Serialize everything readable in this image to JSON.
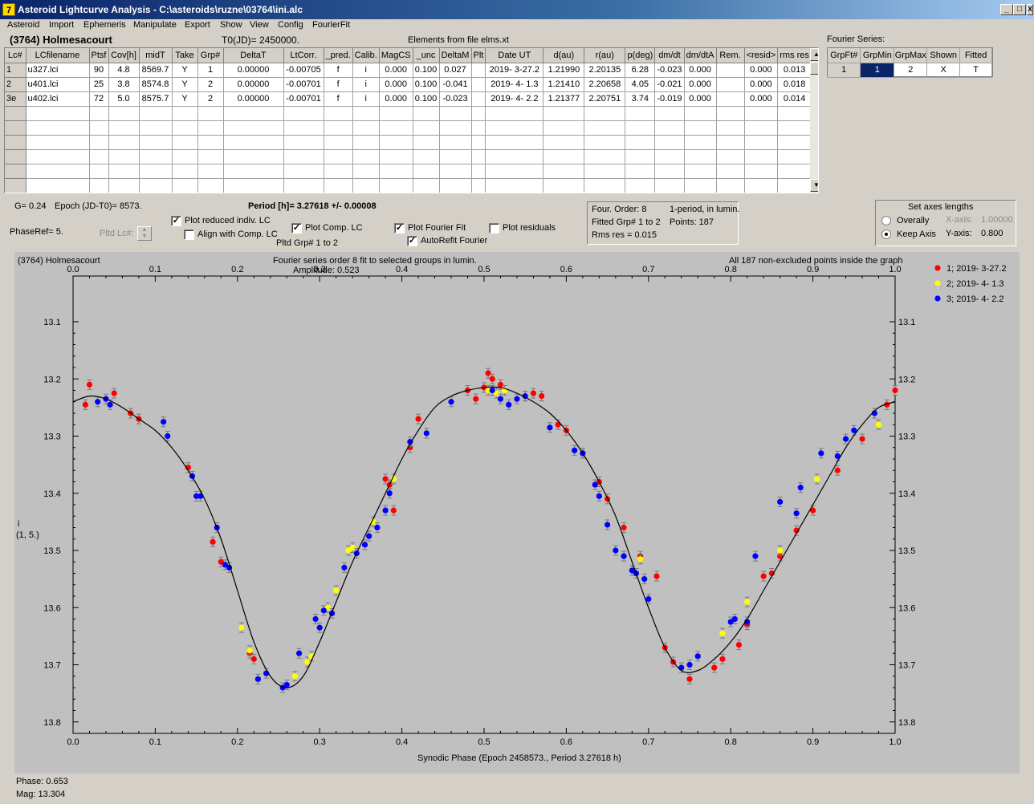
{
  "window": {
    "title": "Asteroid Lightcurve Analysis - C:\\asteroids\\ruzne\\03764\\ini.alc",
    "icon": "7",
    "minimize": "_",
    "maximize": "□",
    "close": "X"
  },
  "menu": [
    "Asteroid",
    "Import",
    "Ephemeris",
    "Manipulate",
    "Export",
    "Show",
    "View",
    "Config",
    "FourierFit"
  ],
  "header": {
    "asteroid": "(3764) Holmesacourt",
    "t0": "T0(JD)= 2450000.",
    "elements": "Elements from file elms.xt",
    "fourier_label": "Fourier Series:"
  },
  "lc_table": {
    "columns": [
      "Lc#",
      "LCfilename",
      "Ptsf",
      "Cov[h]",
      "midT",
      "Take",
      "Grp#",
      "DeltaT",
      "LtCorr.",
      "_pred.",
      "Calib.",
      "MagCS",
      "_unc",
      "DeltaM",
      "Plt",
      "Date UT",
      "d(au)",
      "r(au)",
      "p(deg)",
      "dm/dt",
      "dm/dtA",
      "Rem.",
      "<resid>",
      "rms res"
    ],
    "rows": [
      [
        "1",
        "u327.lci",
        "90",
        "4.8",
        "8569.7",
        "Y",
        "1",
        "0.00000",
        "-0.00705",
        "f",
        "i",
        "0.000",
        "0.100",
        "0.027",
        "",
        "2019- 3-27.2",
        "1.21990",
        "2.20135",
        "6.28",
        "-0.023",
        "0.000",
        "",
        "0.000",
        "0.013"
      ],
      [
        "2",
        "u401.lci",
        "25",
        "3.8",
        "8574.8",
        "Y",
        "2",
        "0.00000",
        "-0.00701",
        "f",
        "i",
        "0.000",
        "0.100",
        "-0.041",
        "",
        "2019- 4- 1.3",
        "1.21410",
        "2.20658",
        "4.05",
        "-0.021",
        "0.000",
        "",
        "0.000",
        "0.018"
      ],
      [
        "3e",
        "u402.lci",
        "72",
        "5.0",
        "8575.7",
        "Y",
        "2",
        "0.00000",
        "-0.00701",
        "f",
        "i",
        "0.000",
        "0.100",
        "-0.023",
        "",
        "2019- 4- 2.2",
        "1.21377",
        "2.20751",
        "3.74",
        "-0.019",
        "0.000",
        "",
        "0.000",
        "0.014"
      ]
    ],
    "empty_rows": 6,
    "scroll_up": "▲",
    "scroll_down": "▼"
  },
  "fourier_table": {
    "columns": [
      "GrpFt#",
      "GrpMin",
      "GrpMax",
      "Shown",
      "Fitted"
    ],
    "row": [
      "1",
      "1",
      "2",
      "X",
      "T"
    ]
  },
  "info": {
    "g": "G= 0.24",
    "epoch": "Epoch (JD-T0)= 8573.",
    "period": "Period [h]= 3.27618 +/- 0.00008",
    "phaseref": "PhaseRef= 5.",
    "pltd_lc": "Pltd Lc#:",
    "pltd_grp": "Pltd Grp#  1   to   2"
  },
  "checks": [
    {
      "label": "Plot reduced indiv. LC",
      "on": true
    },
    {
      "label": "Align with Comp. LC",
      "on": false
    },
    {
      "label": "Plot Comp. LC",
      "on": true
    },
    {
      "label": "Plot Fourier Fit",
      "on": true
    },
    {
      "label": "AutoRefit Fourier",
      "on": true
    },
    {
      "label": "Plot residuals",
      "on": false
    }
  ],
  "fourier_info": {
    "order": "Four. Order:  8",
    "period_mode": "1-period, in lumin.",
    "fitted": "Fitted Grp# 1 to 2",
    "points": "Points: 187",
    "rms": "Rms res     = 0.015"
  },
  "axes_panel": {
    "title": "Set axes lengths",
    "overall": "Overally",
    "keep": "Keep Axis",
    "x_label": "X-axis:",
    "x_value": "1.00000",
    "y_label": "Y-axis:",
    "y_value": "0.800"
  },
  "plot": {
    "top_left": "(3764) Holmesacourt",
    "top_center_1": "Fourier series order 8 fit to selected groups in lumin.",
    "top_center_2": "Amplitude: 0.523",
    "top_right": "All 187 non-excluded points inside the graph",
    "ylabel_1": "i",
    "ylabel_2": "(1, 5.)",
    "xlabel": "Synodic Phase (Epoch 2458573., Period 3.27618 h)"
  },
  "status": {
    "phase": "Phase:  0.653",
    "mag": "Mag:    13.304"
  },
  "chart_data": {
    "type": "scatter",
    "title": "Fourier series order 8 fit to selected groups in lumin.",
    "xlabel": "Synodic Phase (Epoch 2458573., Period 3.27618 h)",
    "ylabel": "i",
    "xlim": [
      0,
      1
    ],
    "ylim": [
      13.1,
      13.9
    ],
    "y_inverted": true,
    "grid": false,
    "legend": "top-right, outside plot",
    "xticks": [
      "0.0",
      "0.1",
      "0.2",
      "0.3",
      "0.4",
      "0.5",
      "0.6",
      "0.7",
      "0.8",
      "0.9",
      "1.0"
    ],
    "yticks": [
      "13.1",
      "13.2",
      "13.3",
      "13.4",
      "13.5",
      "13.6",
      "13.7",
      "13.8"
    ],
    "fit_curve": {
      "x": [
        0,
        0.02,
        0.04,
        0.06,
        0.08,
        0.1,
        0.12,
        0.14,
        0.16,
        0.18,
        0.2,
        0.22,
        0.24,
        0.26,
        0.28,
        0.3,
        0.32,
        0.34,
        0.36,
        0.38,
        0.4,
        0.42,
        0.44,
        0.46,
        0.48,
        0.5,
        0.52,
        0.54,
        0.56,
        0.58,
        0.6,
        0.62,
        0.64,
        0.66,
        0.68,
        0.7,
        0.72,
        0.74,
        0.76,
        0.78,
        0.8,
        0.82,
        0.84,
        0.86,
        0.88,
        0.9,
        0.92,
        0.94,
        0.96,
        0.98,
        1.0
      ],
      "y": [
        13.24,
        13.23,
        13.235,
        13.25,
        13.27,
        13.29,
        13.32,
        13.36,
        13.41,
        13.48,
        13.57,
        13.66,
        13.72,
        13.74,
        13.72,
        13.66,
        13.59,
        13.52,
        13.46,
        13.4,
        13.34,
        13.29,
        13.25,
        13.23,
        13.22,
        13.215,
        13.215,
        13.225,
        13.24,
        13.26,
        13.29,
        13.33,
        13.38,
        13.44,
        13.52,
        13.6,
        13.67,
        13.71,
        13.71,
        13.69,
        13.66,
        13.62,
        13.57,
        13.52,
        13.47,
        13.42,
        13.37,
        13.32,
        13.28,
        13.25,
        13.24
      ]
    },
    "series": [
      {
        "name": "1; 2019- 3-27.2",
        "color": "#ff0000",
        "x": [
          0.015,
          0.02,
          0.05,
          0.07,
          0.08,
          0.14,
          0.17,
          0.18,
          0.215,
          0.22,
          0.38,
          0.385,
          0.39,
          0.41,
          0.42,
          0.48,
          0.49,
          0.5,
          0.505,
          0.51,
          0.52,
          0.56,
          0.57,
          0.59,
          0.6,
          0.62,
          0.64,
          0.65,
          0.67,
          0.69,
          0.71,
          0.72,
          0.73,
          0.75,
          0.78,
          0.79,
          0.81,
          0.82,
          0.84,
          0.85,
          0.86,
          0.88,
          0.9,
          0.93,
          0.96,
          0.99,
          1.0
        ],
        "y": [
          13.245,
          13.21,
          13.225,
          13.26,
          13.27,
          13.355,
          13.485,
          13.52,
          13.68,
          13.69,
          13.375,
          13.385,
          13.43,
          13.32,
          13.27,
          13.22,
          13.235,
          13.215,
          13.19,
          13.2,
          13.21,
          13.225,
          13.23,
          13.28,
          13.29,
          13.33,
          13.38,
          13.41,
          13.46,
          13.51,
          13.545,
          13.67,
          13.695,
          13.725,
          13.705,
          13.69,
          13.665,
          13.63,
          13.545,
          13.54,
          13.51,
          13.465,
          13.43,
          13.36,
          13.305,
          13.245,
          13.22
        ]
      },
      {
        "name": "2; 2019- 4- 1.3",
        "color": "#ffff00",
        "x": [
          0.205,
          0.215,
          0.27,
          0.285,
          0.29,
          0.31,
          0.32,
          0.335,
          0.34,
          0.365,
          0.39,
          0.505,
          0.515,
          0.525,
          0.55,
          0.69,
          0.79,
          0.82,
          0.86,
          0.905,
          0.98
        ],
        "y": [
          13.635,
          13.675,
          13.72,
          13.695,
          13.685,
          13.6,
          13.57,
          13.5,
          13.495,
          13.45,
          13.375,
          13.22,
          13.225,
          13.22,
          13.23,
          13.515,
          13.645,
          13.59,
          13.5,
          13.375,
          13.28
        ]
      },
      {
        "name": "3; 2019- 4- 2.2",
        "color": "#0000ff",
        "x": [
          0.03,
          0.04,
          0.045,
          0.11,
          0.115,
          0.145,
          0.15,
          0.155,
          0.175,
          0.185,
          0.19,
          0.225,
          0.235,
          0.255,
          0.26,
          0.275,
          0.295,
          0.3,
          0.305,
          0.315,
          0.33,
          0.345,
          0.355,
          0.36,
          0.37,
          0.38,
          0.385,
          0.41,
          0.43,
          0.46,
          0.51,
          0.52,
          0.53,
          0.54,
          0.55,
          0.58,
          0.61,
          0.62,
          0.635,
          0.64,
          0.65,
          0.66,
          0.67,
          0.68,
          0.685,
          0.695,
          0.7,
          0.74,
          0.75,
          0.76,
          0.8,
          0.805,
          0.82,
          0.83,
          0.86,
          0.88,
          0.885,
          0.91,
          0.93,
          0.94,
          0.95,
          0.975
        ],
        "y": [
          13.24,
          13.235,
          13.245,
          13.275,
          13.3,
          13.37,
          13.405,
          13.405,
          13.46,
          13.525,
          13.53,
          13.725,
          13.715,
          13.74,
          13.735,
          13.68,
          13.62,
          13.635,
          13.605,
          13.61,
          13.53,
          13.505,
          13.49,
          13.475,
          13.46,
          13.43,
          13.4,
          13.31,
          13.295,
          13.24,
          13.22,
          13.235,
          13.245,
          13.235,
          13.23,
          13.285,
          13.325,
          13.33,
          13.385,
          13.405,
          13.455,
          13.5,
          13.51,
          13.535,
          13.54,
          13.55,
          13.585,
          13.705,
          13.7,
          13.685,
          13.625,
          13.62,
          13.625,
          13.51,
          13.415,
          13.435,
          13.39,
          13.33,
          13.335,
          13.305,
          13.29,
          13.26
        ]
      }
    ]
  }
}
